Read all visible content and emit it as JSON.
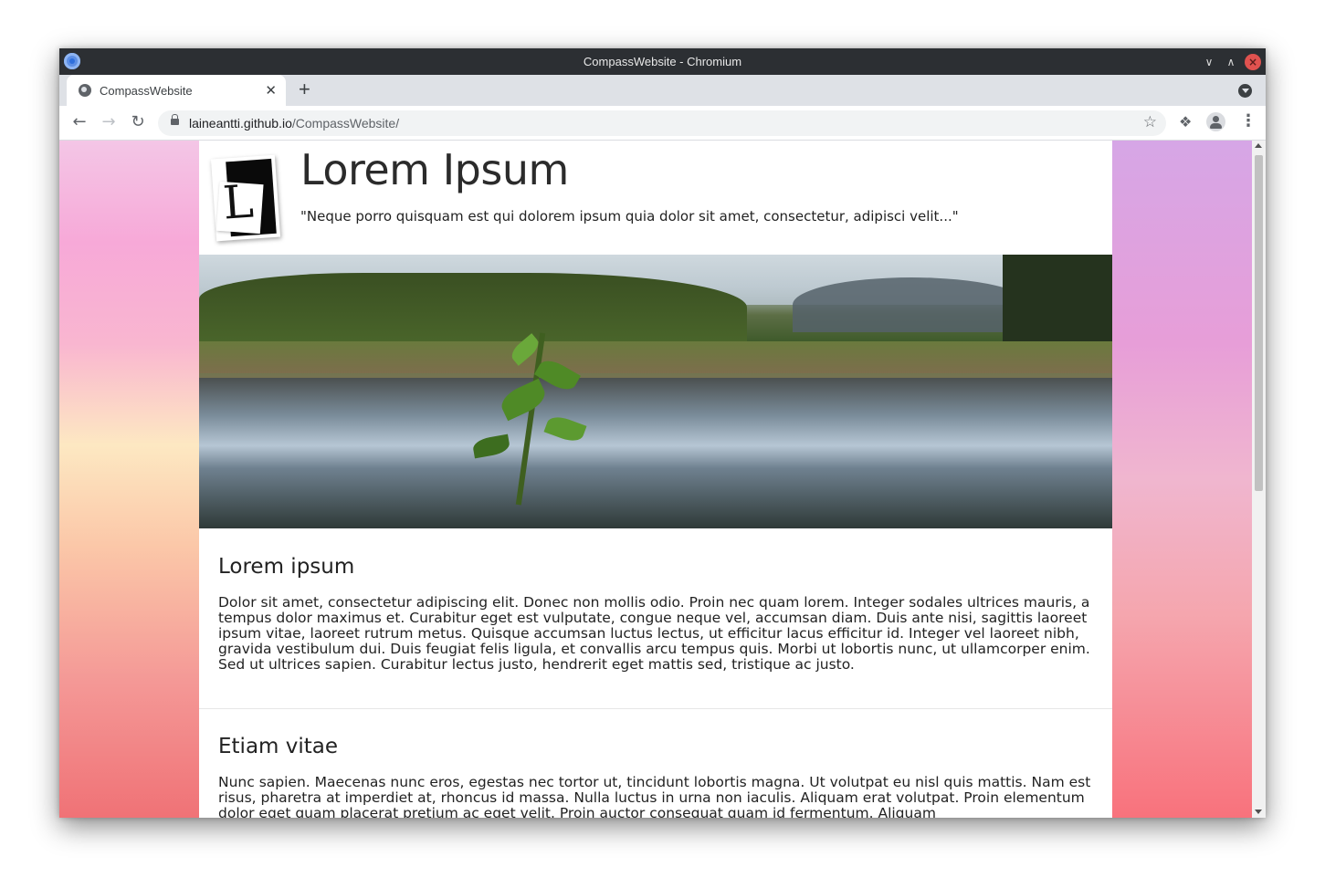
{
  "window": {
    "title": "CompassWebsite - Chromium"
  },
  "tab": {
    "title": "CompassWebsite",
    "close": "✕",
    "new_tab": "+"
  },
  "address_bar": {
    "host": "laineantti.github.io",
    "path": "/CompassWebsite/"
  },
  "site": {
    "title": "Lorem Ipsum",
    "tagline": "\"Neque porro quisquam est qui dolorem ipsum quia dolor sit amet, consectetur, adipisci velit...\"",
    "logo_letter": "L"
  },
  "sections": [
    {
      "heading": "Lorem ipsum",
      "body": "Dolor sit amet, consectetur adipiscing elit. Donec non mollis odio. Proin nec quam lorem. Integer sodales ultrices mauris, a tempus dolor maximus et. Curabitur eget est vulputate, congue neque vel, accumsan diam. Duis ante nisi, sagittis laoreet ipsum vitae, laoreet rutrum metus. Quisque accumsan luctus lectus, ut efficitur lacus efficitur id. Integer vel laoreet nibh, gravida vestibulum dui. Duis feugiat felis ligula, et convallis arcu tempus quis. Morbi ut lobortis nunc, ut ullamcorper enim. Sed ut ultrices sapien. Curabitur lectus justo, hendrerit eget mattis sed, tristique ac justo."
    },
    {
      "heading": "Etiam vitae",
      "body": "Nunc sapien. Maecenas nunc eros, egestas nec tortor ut, tincidunt lobortis magna. Ut volutpat eu nisl quis mattis. Nam est risus, pharetra at imperdiet at, rhoncus id massa. Nulla luctus in urna non iaculis. Aliquam erat volutpat. Proin elementum dolor eget quam placerat pretium ac eget velit. Proin auctor consequat quam id fermentum. Aliquam"
    }
  ],
  "icons": {
    "back": "arrow-left-icon",
    "forward": "arrow-right-icon",
    "reload": "reload-icon",
    "lock": "lock-icon",
    "star": "star-icon",
    "extensions": "puzzle-icon",
    "profile": "profile-icon",
    "menu": "kebab-menu-icon"
  },
  "colors": {
    "titlebar": "#2c2f33",
    "tabstrip": "#dee1e6",
    "close_button": "#e0524f"
  }
}
